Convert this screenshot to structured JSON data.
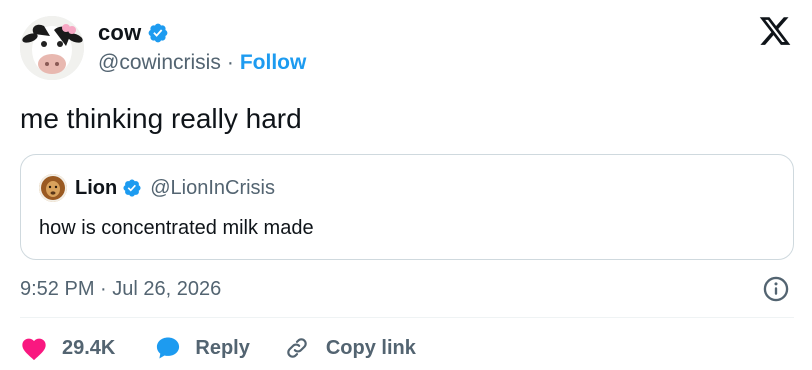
{
  "author": {
    "display_name": "cow",
    "handle": "@cowincrisis",
    "separator": "·",
    "follow_label": "Follow",
    "verified": true,
    "avatar_icon": "cow-avatar"
  },
  "tweet": {
    "text": "me thinking really hard",
    "timestamp": "9:52 PM · Jul 26, 2026"
  },
  "quote": {
    "display_name": "Lion",
    "handle": "@LionInCrisis",
    "text": "how is concentrated milk made",
    "verified": true,
    "avatar_icon": "lion-avatar"
  },
  "actions": {
    "like_count": "29.4K",
    "reply_label": "Reply",
    "copy_label": "Copy link"
  },
  "icons": {
    "platform": "x-logo-icon",
    "verified": "verified-badge-icon",
    "info": "info-icon",
    "like": "heart-icon",
    "reply": "speech-bubble-icon",
    "copy": "link-icon"
  },
  "colors": {
    "accent": "#1d9bf0",
    "heart": "#f91880",
    "secondary_text": "#536471",
    "primary_text": "#0f1419",
    "border": "#cfd9de"
  }
}
